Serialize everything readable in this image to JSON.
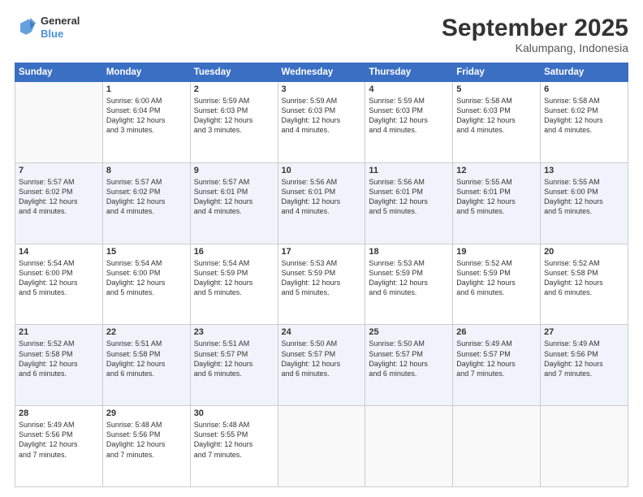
{
  "logo": {
    "line1": "General",
    "line2": "Blue"
  },
  "header": {
    "month": "September 2025",
    "location": "Kalumpang, Indonesia"
  },
  "weekdays": [
    "Sunday",
    "Monday",
    "Tuesday",
    "Wednesday",
    "Thursday",
    "Friday",
    "Saturday"
  ],
  "weeks": [
    [
      {
        "day": "",
        "info": ""
      },
      {
        "day": "1",
        "info": "Sunrise: 6:00 AM\nSunset: 6:04 PM\nDaylight: 12 hours\nand 3 minutes."
      },
      {
        "day": "2",
        "info": "Sunrise: 5:59 AM\nSunset: 6:03 PM\nDaylight: 12 hours\nand 3 minutes."
      },
      {
        "day": "3",
        "info": "Sunrise: 5:59 AM\nSunset: 6:03 PM\nDaylight: 12 hours\nand 4 minutes."
      },
      {
        "day": "4",
        "info": "Sunrise: 5:59 AM\nSunset: 6:03 PM\nDaylight: 12 hours\nand 4 minutes."
      },
      {
        "day": "5",
        "info": "Sunrise: 5:58 AM\nSunset: 6:03 PM\nDaylight: 12 hours\nand 4 minutes."
      },
      {
        "day": "6",
        "info": "Sunrise: 5:58 AM\nSunset: 6:02 PM\nDaylight: 12 hours\nand 4 minutes."
      }
    ],
    [
      {
        "day": "7",
        "info": "Sunrise: 5:57 AM\nSunset: 6:02 PM\nDaylight: 12 hours\nand 4 minutes."
      },
      {
        "day": "8",
        "info": "Sunrise: 5:57 AM\nSunset: 6:02 PM\nDaylight: 12 hours\nand 4 minutes."
      },
      {
        "day": "9",
        "info": "Sunrise: 5:57 AM\nSunset: 6:01 PM\nDaylight: 12 hours\nand 4 minutes."
      },
      {
        "day": "10",
        "info": "Sunrise: 5:56 AM\nSunset: 6:01 PM\nDaylight: 12 hours\nand 4 minutes."
      },
      {
        "day": "11",
        "info": "Sunrise: 5:56 AM\nSunset: 6:01 PM\nDaylight: 12 hours\nand 5 minutes."
      },
      {
        "day": "12",
        "info": "Sunrise: 5:55 AM\nSunset: 6:01 PM\nDaylight: 12 hours\nand 5 minutes."
      },
      {
        "day": "13",
        "info": "Sunrise: 5:55 AM\nSunset: 6:00 PM\nDaylight: 12 hours\nand 5 minutes."
      }
    ],
    [
      {
        "day": "14",
        "info": "Sunrise: 5:54 AM\nSunset: 6:00 PM\nDaylight: 12 hours\nand 5 minutes."
      },
      {
        "day": "15",
        "info": "Sunrise: 5:54 AM\nSunset: 6:00 PM\nDaylight: 12 hours\nand 5 minutes."
      },
      {
        "day": "16",
        "info": "Sunrise: 5:54 AM\nSunset: 5:59 PM\nDaylight: 12 hours\nand 5 minutes."
      },
      {
        "day": "17",
        "info": "Sunrise: 5:53 AM\nSunset: 5:59 PM\nDaylight: 12 hours\nand 5 minutes."
      },
      {
        "day": "18",
        "info": "Sunrise: 5:53 AM\nSunset: 5:59 PM\nDaylight: 12 hours\nand 6 minutes."
      },
      {
        "day": "19",
        "info": "Sunrise: 5:52 AM\nSunset: 5:59 PM\nDaylight: 12 hours\nand 6 minutes."
      },
      {
        "day": "20",
        "info": "Sunrise: 5:52 AM\nSunset: 5:58 PM\nDaylight: 12 hours\nand 6 minutes."
      }
    ],
    [
      {
        "day": "21",
        "info": "Sunrise: 5:52 AM\nSunset: 5:58 PM\nDaylight: 12 hours\nand 6 minutes."
      },
      {
        "day": "22",
        "info": "Sunrise: 5:51 AM\nSunset: 5:58 PM\nDaylight: 12 hours\nand 6 minutes."
      },
      {
        "day": "23",
        "info": "Sunrise: 5:51 AM\nSunset: 5:57 PM\nDaylight: 12 hours\nand 6 minutes."
      },
      {
        "day": "24",
        "info": "Sunrise: 5:50 AM\nSunset: 5:57 PM\nDaylight: 12 hours\nand 6 minutes."
      },
      {
        "day": "25",
        "info": "Sunrise: 5:50 AM\nSunset: 5:57 PM\nDaylight: 12 hours\nand 6 minutes."
      },
      {
        "day": "26",
        "info": "Sunrise: 5:49 AM\nSunset: 5:57 PM\nDaylight: 12 hours\nand 7 minutes."
      },
      {
        "day": "27",
        "info": "Sunrise: 5:49 AM\nSunset: 5:56 PM\nDaylight: 12 hours\nand 7 minutes."
      }
    ],
    [
      {
        "day": "28",
        "info": "Sunrise: 5:49 AM\nSunset: 5:56 PM\nDaylight: 12 hours\nand 7 minutes."
      },
      {
        "day": "29",
        "info": "Sunrise: 5:48 AM\nSunset: 5:56 PM\nDaylight: 12 hours\nand 7 minutes."
      },
      {
        "day": "30",
        "info": "Sunrise: 5:48 AM\nSunset: 5:55 PM\nDaylight: 12 hours\nand 7 minutes."
      },
      {
        "day": "",
        "info": ""
      },
      {
        "day": "",
        "info": ""
      },
      {
        "day": "",
        "info": ""
      },
      {
        "day": "",
        "info": ""
      }
    ]
  ]
}
